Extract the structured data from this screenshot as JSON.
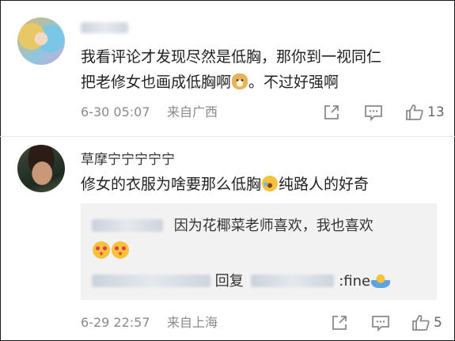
{
  "comments": [
    {
      "username": "",
      "text_line1": "我看评论才发现尽然是低胸，那你到一视同仁",
      "text_line2_before_emoji": "把老修女也画成低胸啊",
      "text_line2_emoji": "doge-emoji",
      "text_line2_after_emoji": "。不过好强啊",
      "timestamp": "6-30 05:07",
      "location": "来自广西",
      "like_count": "13"
    },
    {
      "username": "草摩宁宁宁宁宁",
      "text_before_emoji": "修女的衣服为啥要那么低胸",
      "text_emoji": "laugh-cry-emoji",
      "text_after_emoji": "纯路人的好奇",
      "replies": [
        {
          "text": "因为花椰菜老师喜欢，我也喜欢",
          "emojis": [
            "heart-face-emoji",
            "heart-face-emoji"
          ]
        },
        {
          "middle_text": "回复",
          "after_text": ":fine",
          "emoji": "shrug-emoji"
        }
      ],
      "timestamp": "6-29 22:57",
      "location": "来自上海",
      "like_count": "5"
    }
  ],
  "icons": {
    "share": "share-icon",
    "comment": "comment-icon",
    "like": "thumbs-up-icon"
  },
  "colors": {
    "text_primary": "#222222",
    "text_meta": "#8a8a8a",
    "reply_background": "#f2f2f2",
    "separator": "#e8e8e8"
  }
}
